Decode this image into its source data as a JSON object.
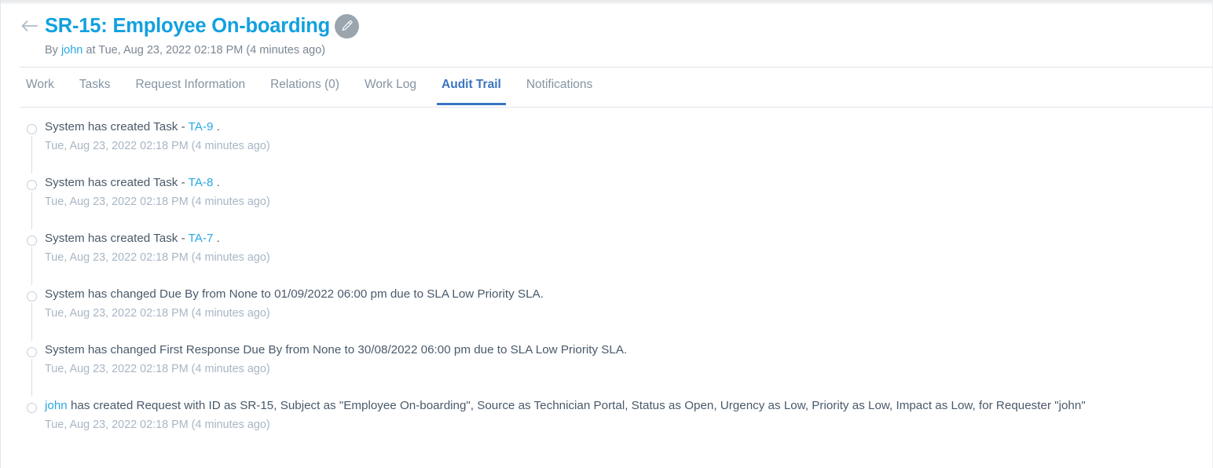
{
  "header": {
    "back_icon": "arrow-left-icon",
    "title": "SR-15: Employee On-boarding",
    "edit_icon": "pencil-icon",
    "byline_prefix": "By",
    "author": "john",
    "byline_middle": "at",
    "created_at": "Tue, Aug 23, 2022 02:18 PM",
    "created_relative": "(4 minutes ago)"
  },
  "tabs": [
    {
      "label": "Work",
      "active": false
    },
    {
      "label": "Tasks",
      "active": false
    },
    {
      "label": "Request Information",
      "active": false
    },
    {
      "label": "Relations (0)",
      "active": false
    },
    {
      "label": "Work Log",
      "active": false
    },
    {
      "label": "Audit Trail",
      "active": true
    },
    {
      "label": "Notifications",
      "active": false
    }
  ],
  "audit_trail": [
    {
      "before": "System has created Task - ",
      "link": "TA-9",
      "after": " .",
      "timestamp": "Tue, Aug 23, 2022 02:18 PM (4 minutes ago)"
    },
    {
      "before": "System has created Task - ",
      "link": "TA-8",
      "after": " .",
      "timestamp": "Tue, Aug 23, 2022 02:18 PM (4 minutes ago)"
    },
    {
      "before": "System has created Task - ",
      "link": "TA-7",
      "after": " .",
      "timestamp": "Tue, Aug 23, 2022 02:18 PM (4 minutes ago)"
    },
    {
      "before": "System has changed Due By from None to 01/09/2022 06:00 pm due to SLA Low Priority SLA.",
      "link": "",
      "after": "",
      "timestamp": "Tue, Aug 23, 2022 02:18 PM (4 minutes ago)"
    },
    {
      "before": "System has changed First Response Due By from None to 30/08/2022 06:00 pm due to SLA Low Priority SLA.",
      "link": "",
      "after": "",
      "timestamp": "Tue, Aug 23, 2022 02:18 PM (4 minutes ago)"
    },
    {
      "before": "",
      "link": "john",
      "after": " has created Request with ID as SR-15, Subject as \"Employee On-boarding\", Source as Technician Portal, Status as Open, Urgency as Low, Priority as Low, Impact as Low, for Requester \"john\"",
      "timestamp": "Tue, Aug 23, 2022 02:18 PM (4 minutes ago)"
    }
  ],
  "colors": {
    "title_blue": "#12a0e0",
    "link_blue": "#2aa8e2",
    "active_tab_blue": "#3875c0",
    "text_gray": "#4a5a6a",
    "muted_gray": "#a8b6c4",
    "edit_badge_gray": "#9aa5ae"
  }
}
